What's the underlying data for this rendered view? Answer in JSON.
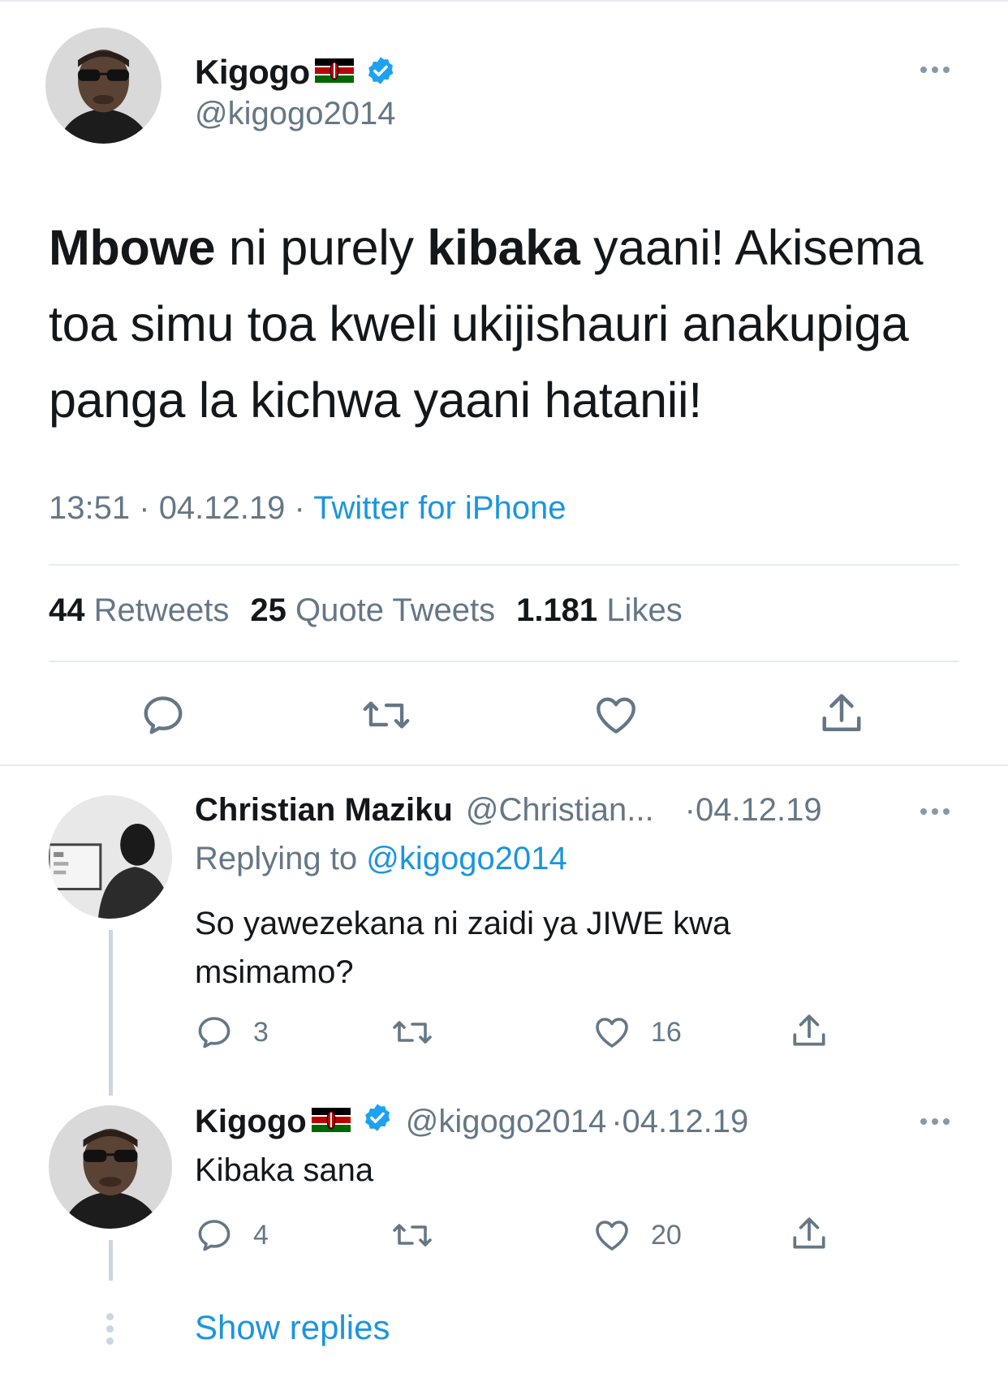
{
  "main_tweet": {
    "author_name": "Kigogo",
    "author_handle": "@kigogo2014",
    "text_parts": [
      {
        "t": "Mbowe",
        "bold": true
      },
      {
        "t": " ni purely ",
        "bold": false
      },
      {
        "t": "kibaka",
        "bold": true
      },
      {
        "t": " yaani! Akisema toa simu toa kweli ukijishauri anakupiga panga la kichwa yaani hatanii!",
        "bold": false
      }
    ],
    "time": "13:51",
    "date": "04.12.19",
    "source": "Twitter for iPhone",
    "stats": {
      "retweets_count": "44",
      "retweets_label": "Retweets",
      "quotes_count": "25",
      "quotes_label": "Quote Tweets",
      "likes_count": "1.181",
      "likes_label": "Likes"
    },
    "icons": [
      "reply-icon",
      "retweet-icon",
      "like-icon",
      "share-icon"
    ]
  },
  "replies": [
    {
      "author_name": "Christian Maziku",
      "author_handle": "@Christian...",
      "date": "04.12.19",
      "replying_label": "Replying to",
      "replying_to": "@kigogo2014",
      "text": "So yawezekana ni zaidi ya JIWE kwa msimamo?",
      "reply_count": "3",
      "like_count": "16"
    },
    {
      "author_name": "Kigogo",
      "author_handle": "@kigogo2014",
      "date": "04.12.19",
      "text": "Kibaka sana",
      "reply_count": "4",
      "like_count": "20"
    }
  ],
  "show_replies_label": "Show replies",
  "colors": {
    "accent": "#1b95e0",
    "verified": "#1da1f2",
    "secondary_text": "#657786",
    "divider": "#e6ecf0"
  },
  "separator_dot": "·"
}
